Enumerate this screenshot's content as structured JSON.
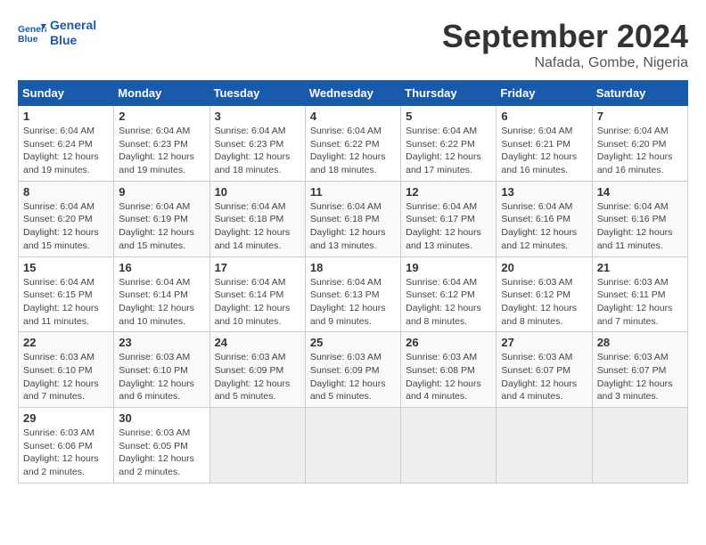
{
  "header": {
    "logo_line1": "General",
    "logo_line2": "Blue",
    "month": "September 2024",
    "location": "Nafada, Gombe, Nigeria"
  },
  "columns": [
    "Sunday",
    "Monday",
    "Tuesday",
    "Wednesday",
    "Thursday",
    "Friday",
    "Saturday"
  ],
  "weeks": [
    [
      {
        "day": "1",
        "sunrise": "6:04 AM",
        "sunset": "6:24 PM",
        "daylight": "12 hours and 19 minutes."
      },
      {
        "day": "2",
        "sunrise": "6:04 AM",
        "sunset": "6:23 PM",
        "daylight": "12 hours and 19 minutes."
      },
      {
        "day": "3",
        "sunrise": "6:04 AM",
        "sunset": "6:23 PM",
        "daylight": "12 hours and 18 minutes."
      },
      {
        "day": "4",
        "sunrise": "6:04 AM",
        "sunset": "6:22 PM",
        "daylight": "12 hours and 18 minutes."
      },
      {
        "day": "5",
        "sunrise": "6:04 AM",
        "sunset": "6:22 PM",
        "daylight": "12 hours and 17 minutes."
      },
      {
        "day": "6",
        "sunrise": "6:04 AM",
        "sunset": "6:21 PM",
        "daylight": "12 hours and 16 minutes."
      },
      {
        "day": "7",
        "sunrise": "6:04 AM",
        "sunset": "6:20 PM",
        "daylight": "12 hours and 16 minutes."
      }
    ],
    [
      {
        "day": "8",
        "sunrise": "6:04 AM",
        "sunset": "6:20 PM",
        "daylight": "12 hours and 15 minutes."
      },
      {
        "day": "9",
        "sunrise": "6:04 AM",
        "sunset": "6:19 PM",
        "daylight": "12 hours and 15 minutes."
      },
      {
        "day": "10",
        "sunrise": "6:04 AM",
        "sunset": "6:18 PM",
        "daylight": "12 hours and 14 minutes."
      },
      {
        "day": "11",
        "sunrise": "6:04 AM",
        "sunset": "6:18 PM",
        "daylight": "12 hours and 13 minutes."
      },
      {
        "day": "12",
        "sunrise": "6:04 AM",
        "sunset": "6:17 PM",
        "daylight": "12 hours and 13 minutes."
      },
      {
        "day": "13",
        "sunrise": "6:04 AM",
        "sunset": "6:16 PM",
        "daylight": "12 hours and 12 minutes."
      },
      {
        "day": "14",
        "sunrise": "6:04 AM",
        "sunset": "6:16 PM",
        "daylight": "12 hours and 11 minutes."
      }
    ],
    [
      {
        "day": "15",
        "sunrise": "6:04 AM",
        "sunset": "6:15 PM",
        "daylight": "12 hours and 11 minutes."
      },
      {
        "day": "16",
        "sunrise": "6:04 AM",
        "sunset": "6:14 PM",
        "daylight": "12 hours and 10 minutes."
      },
      {
        "day": "17",
        "sunrise": "6:04 AM",
        "sunset": "6:14 PM",
        "daylight": "12 hours and 10 minutes."
      },
      {
        "day": "18",
        "sunrise": "6:04 AM",
        "sunset": "6:13 PM",
        "daylight": "12 hours and 9 minutes."
      },
      {
        "day": "19",
        "sunrise": "6:04 AM",
        "sunset": "6:12 PM",
        "daylight": "12 hours and 8 minutes."
      },
      {
        "day": "20",
        "sunrise": "6:03 AM",
        "sunset": "6:12 PM",
        "daylight": "12 hours and 8 minutes."
      },
      {
        "day": "21",
        "sunrise": "6:03 AM",
        "sunset": "6:11 PM",
        "daylight": "12 hours and 7 minutes."
      }
    ],
    [
      {
        "day": "22",
        "sunrise": "6:03 AM",
        "sunset": "6:10 PM",
        "daylight": "12 hours and 7 minutes."
      },
      {
        "day": "23",
        "sunrise": "6:03 AM",
        "sunset": "6:10 PM",
        "daylight": "12 hours and 6 minutes."
      },
      {
        "day": "24",
        "sunrise": "6:03 AM",
        "sunset": "6:09 PM",
        "daylight": "12 hours and 5 minutes."
      },
      {
        "day": "25",
        "sunrise": "6:03 AM",
        "sunset": "6:09 PM",
        "daylight": "12 hours and 5 minutes."
      },
      {
        "day": "26",
        "sunrise": "6:03 AM",
        "sunset": "6:08 PM",
        "daylight": "12 hours and 4 minutes."
      },
      {
        "day": "27",
        "sunrise": "6:03 AM",
        "sunset": "6:07 PM",
        "daylight": "12 hours and 4 minutes."
      },
      {
        "day": "28",
        "sunrise": "6:03 AM",
        "sunset": "6:07 PM",
        "daylight": "12 hours and 3 minutes."
      }
    ],
    [
      {
        "day": "29",
        "sunrise": "6:03 AM",
        "sunset": "6:06 PM",
        "daylight": "12 hours and 2 minutes."
      },
      {
        "day": "30",
        "sunrise": "6:03 AM",
        "sunset": "6:05 PM",
        "daylight": "12 hours and 2 minutes."
      },
      null,
      null,
      null,
      null,
      null
    ]
  ]
}
